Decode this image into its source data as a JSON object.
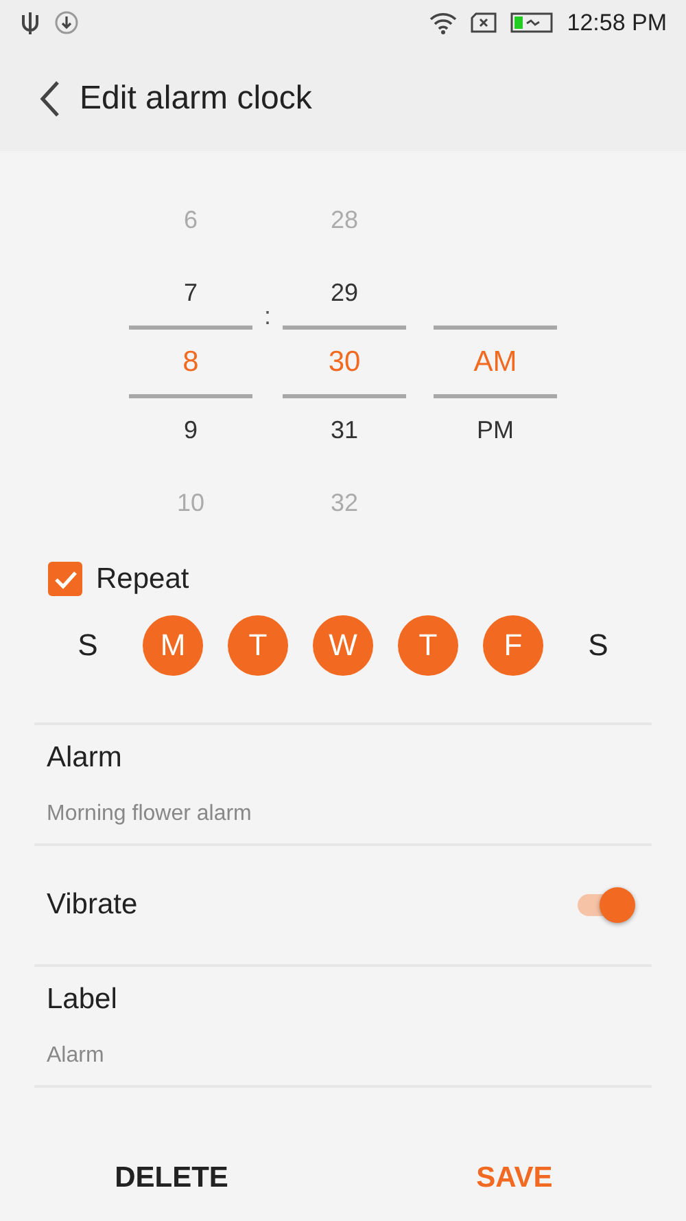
{
  "status_bar": {
    "time": "12:58 PM"
  },
  "header": {
    "title": "Edit alarm clock"
  },
  "picker": {
    "separator": ":",
    "columns": [
      {
        "items": [
          {
            "text": "6",
            "selected": false
          },
          {
            "text": "7",
            "selected": false
          },
          {
            "text": "8",
            "selected": true
          },
          {
            "text": "9",
            "selected": false
          },
          {
            "text": "10",
            "selected": false
          }
        ]
      },
      {
        "items": [
          {
            "text": "28",
            "selected": false
          },
          {
            "text": "29",
            "selected": false
          },
          {
            "text": "30",
            "selected": true
          },
          {
            "text": "31",
            "selected": false
          },
          {
            "text": "32",
            "selected": false
          }
        ]
      },
      {
        "items": [
          {
            "text": "AM",
            "selected": true
          },
          {
            "text": "PM",
            "selected": false
          }
        ]
      }
    ]
  },
  "repeat": {
    "label": "Repeat",
    "checked": true
  },
  "days": [
    {
      "letter": "S",
      "selected": false
    },
    {
      "letter": "M",
      "selected": true
    },
    {
      "letter": "T",
      "selected": true
    },
    {
      "letter": "W",
      "selected": true
    },
    {
      "letter": "T",
      "selected": true
    },
    {
      "letter": "F",
      "selected": true
    },
    {
      "letter": "S",
      "selected": false
    }
  ],
  "settings": [
    {
      "kind": "value",
      "title": "Alarm",
      "value": "Morning flower alarm"
    },
    {
      "kind": "toggle",
      "title": "Vibrate",
      "on": true
    },
    {
      "kind": "value",
      "title": "Label",
      "value": "Alarm"
    }
  ],
  "buttons": [
    {
      "kind": "plain",
      "label": "DELETE"
    },
    {
      "kind": "accent",
      "label": "SAVE"
    }
  ]
}
